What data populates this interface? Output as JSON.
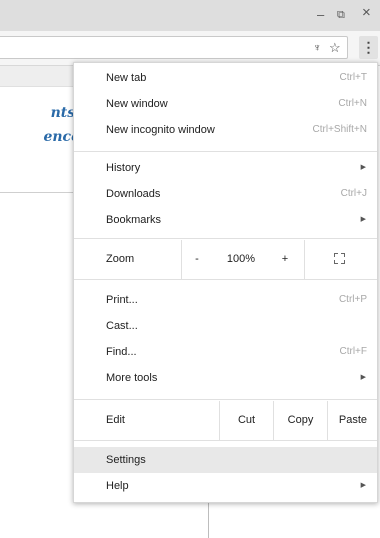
{
  "window": {
    "minimize_glyph": "–",
    "restore_glyph": "⧉",
    "close_glyph": "×"
  },
  "toolbar": {
    "lens_glyph": "♆",
    "star_glyph": "☆",
    "menu_glyph": "⋮"
  },
  "page": {
    "line1": "nts,",
    "line2": "ence"
  },
  "menu": {
    "group1": [
      {
        "label": "New tab",
        "shortcut": "Ctrl+T"
      },
      {
        "label": "New window",
        "shortcut": "Ctrl+N"
      },
      {
        "label": "New incognito window",
        "shortcut": "Ctrl+Shift+N"
      }
    ],
    "group2": [
      {
        "label": "History",
        "arrow": "▶"
      },
      {
        "label": "Downloads",
        "shortcut": "Ctrl+J"
      },
      {
        "label": "Bookmarks",
        "arrow": "▶"
      }
    ],
    "zoom": {
      "label": "Zoom",
      "minus": "-",
      "level": "100%",
      "plus": "+"
    },
    "group3": [
      {
        "label": "Print...",
        "shortcut": "Ctrl+P"
      },
      {
        "label": "Cast..."
      },
      {
        "label": "Find...",
        "shortcut": "Ctrl+F"
      },
      {
        "label": "More tools",
        "arrow": "▶"
      }
    ],
    "edit": {
      "label": "Edit",
      "cut": "Cut",
      "copy": "Copy",
      "paste": "Paste"
    },
    "group4": [
      {
        "label": "Settings"
      },
      {
        "label": "Help",
        "arrow": "▶"
      }
    ]
  }
}
